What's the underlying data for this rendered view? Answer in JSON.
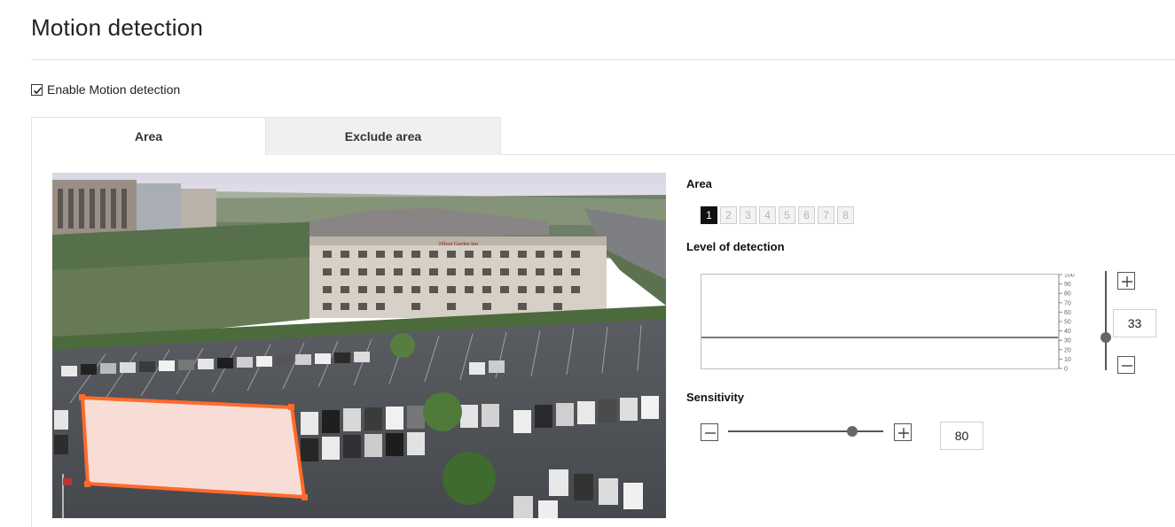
{
  "page": {
    "title": "Motion detection"
  },
  "enable": {
    "label": "Enable Motion detection",
    "checked": true
  },
  "tabs": [
    {
      "label": "Area",
      "active": true
    },
    {
      "label": "Exclude area",
      "active": false
    }
  ],
  "camera": {
    "hotel_sign": "Hilton Garden Inn",
    "region_color": "#ff6a2a",
    "region_fill": "#f8ddd6"
  },
  "area": {
    "label": "Area",
    "buttons": [
      "1",
      "2",
      "3",
      "4",
      "5",
      "6",
      "7",
      "8"
    ],
    "selected": "1"
  },
  "level": {
    "label": "Level of detection",
    "value": "33",
    "scale_ticks": [
      "100",
      "90",
      "80",
      "70",
      "60",
      "50",
      "40",
      "30",
      "20",
      "10",
      "0"
    ],
    "plus_icon": "plus-icon",
    "minus_icon": "minus-icon"
  },
  "sensitivity": {
    "label": "Sensitivity",
    "value": "80",
    "plus_icon": "plus-icon",
    "minus_icon": "minus-icon"
  },
  "colors": {
    "accent": "#ff6a2a",
    "active_area": "#111111",
    "inactive_tab": "#f0f0f0"
  }
}
